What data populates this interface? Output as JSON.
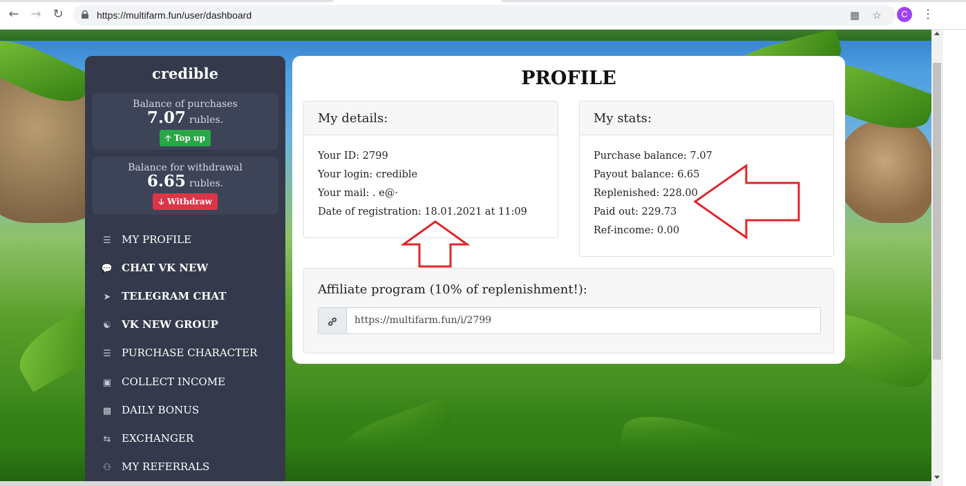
{
  "browser": {
    "url": "https://multifarm.fun/user/dashboard",
    "avatar_letter": "C"
  },
  "sidebar": {
    "username": "credible",
    "purchase_balance": {
      "label": "Balance of purchases",
      "amount": "7.07",
      "unit": "rubles."
    },
    "topup_label": "Top up",
    "withdraw_balance": {
      "label": "Balance for withdrawal",
      "amount": "6.65",
      "unit": "rubles."
    },
    "withdraw_label": "Withdraw",
    "menu": [
      {
        "label": "MY PROFILE",
        "icon": "bars-icon"
      },
      {
        "label": "CHAT VK NEW",
        "icon": "comments-icon"
      },
      {
        "label": "TELEGRAM CHAT",
        "icon": "paper-plane-icon"
      },
      {
        "label": "VK NEW GROUP",
        "icon": "handshake-icon"
      },
      {
        "label": "PURCHASE CHARACTER",
        "icon": "bars-icon"
      },
      {
        "label": "COLLECT INCOME",
        "icon": "money-bill-icon"
      },
      {
        "label": "DAILY BONUS",
        "icon": "gift-icon"
      },
      {
        "label": "EXCHANGER",
        "icon": "exchange-icon"
      },
      {
        "label": "MY REFERRALS",
        "icon": "users-icon"
      }
    ]
  },
  "profile": {
    "title": "PROFILE",
    "details": {
      "header": "My details:",
      "rows": [
        "Your ID: 2799",
        "Your login: credible",
        "Your mail:  .                    e@·",
        "Date of registration: 18.01.2021 at 11:09"
      ]
    },
    "stats": {
      "header": "My stats:",
      "rows": [
        "Purchase balance: 7.07",
        "Payout balance: 6.65",
        "Replenished: 228.00",
        "Paid out: 229.73",
        "Ref-income: 0.00"
      ]
    },
    "affiliate": {
      "header": "Affiliate program (10% of replenishment!):",
      "link": "https://multifarm.fun/i/2799"
    }
  },
  "colors": {
    "sidebar_bg": "#343a4c",
    "topup_green": "#28a745",
    "withdraw_red": "#dc3545",
    "annotation_red": "#e0242a"
  }
}
